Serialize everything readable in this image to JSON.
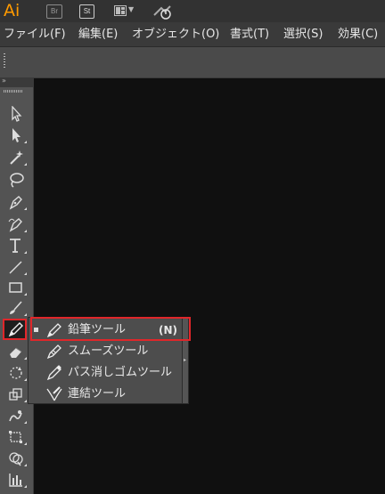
{
  "app": {
    "logo": "Ai",
    "bridge_label": "Br",
    "stock_label": "St",
    "workspace_icon": "layout-grid-icon",
    "sync_icon": "sync-icon"
  },
  "menu": {
    "items": [
      {
        "label": "ファイル(F)"
      },
      {
        "label": "編集(E)"
      },
      {
        "label": "オブジェクト(O)"
      },
      {
        "label": "書式(T)"
      },
      {
        "label": "選択(S)"
      },
      {
        "label": "効果(C)"
      }
    ]
  },
  "toolbox": {
    "collapse_icon": "»",
    "tools": [
      {
        "name": "selection-tool"
      },
      {
        "name": "direct-selection-tool"
      },
      {
        "name": "magic-wand-tool"
      },
      {
        "name": "lasso-tool"
      },
      {
        "name": "pen-tool"
      },
      {
        "name": "curvature-tool"
      },
      {
        "name": "type-tool"
      },
      {
        "name": "line-segment-tool"
      },
      {
        "name": "rectangle-tool"
      },
      {
        "name": "paintbrush-tool"
      },
      {
        "name": "pencil-tool",
        "active": true
      },
      {
        "name": "eraser-tool"
      },
      {
        "name": "rotate-tool"
      },
      {
        "name": "scale-tool"
      },
      {
        "name": "warp-tool"
      },
      {
        "name": "free-transform-tool"
      },
      {
        "name": "shape-builder-tool"
      },
      {
        "name": "graph-tool"
      }
    ]
  },
  "flyout": {
    "items": [
      {
        "label": "鉛筆ツール",
        "shortcut": "(N)",
        "icon": "pencil-icon",
        "selected": true
      },
      {
        "label": "スムーズツール",
        "shortcut": "",
        "icon": "smooth-icon"
      },
      {
        "label": "パス消しゴムツール",
        "shortcut": "",
        "icon": "path-eraser-icon"
      },
      {
        "label": "連結ツール",
        "shortcut": "",
        "icon": "join-icon"
      }
    ]
  },
  "colors": {
    "accent_highlight": "#e0262a",
    "logo": "#ff9a00",
    "canvas": "#101010"
  }
}
